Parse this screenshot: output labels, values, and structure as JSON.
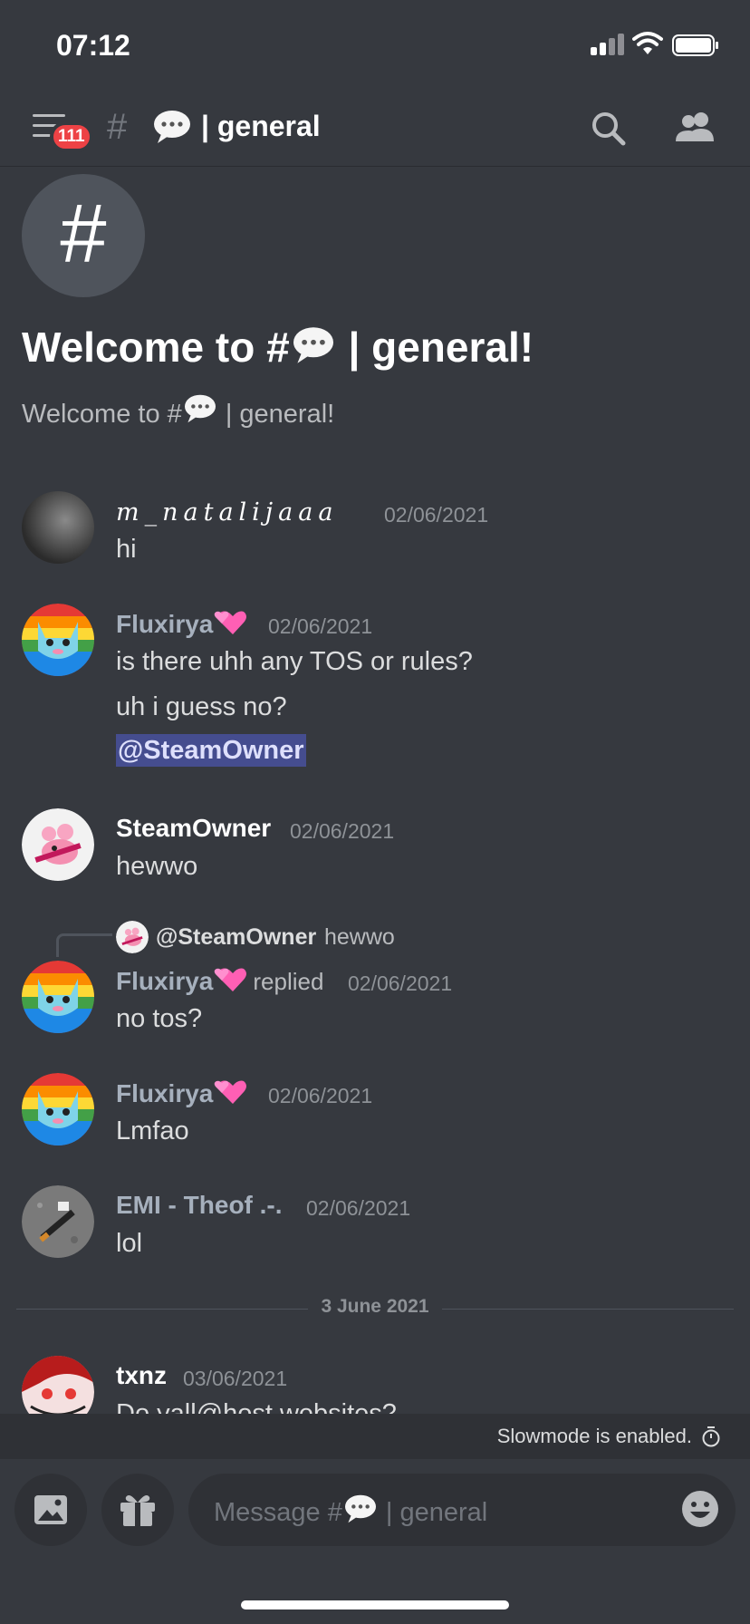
{
  "status_bar": {
    "time": "07:12"
  },
  "header": {
    "badge_count": "111",
    "hash": "#",
    "channel_name": "| general"
  },
  "welcome": {
    "hash_glyph": "#",
    "title_prefix": "Welcome to #",
    "title_suffix": " | general!",
    "subtitle_prefix": "Welcome to #",
    "subtitle_suffix": " | general!"
  },
  "messages": [
    {
      "author": "m_natalijaaa",
      "timestamp": "02/06/2021",
      "lines": [
        "hi"
      ]
    },
    {
      "author": "Fluxirya",
      "timestamp": "02/06/2021",
      "lines": [
        "is there uhh any TOS or rules?",
        "uh i guess no?"
      ],
      "mention": "@SteamOwner"
    },
    {
      "author": "SteamOwner",
      "timestamp": "02/06/2021",
      "lines": [
        "hewwo"
      ]
    },
    {
      "reply_to": {
        "author": "@SteamOwner",
        "text": "hewwo"
      },
      "author": "Fluxirya",
      "replied_label": "replied",
      "timestamp": "02/06/2021",
      "lines": [
        "no tos?"
      ]
    },
    {
      "author": "Fluxirya",
      "timestamp": "02/06/2021",
      "lines": [
        "Lmfao"
      ]
    },
    {
      "author": "EMI - Theof .-.",
      "timestamp": "02/06/2021",
      "lines": [
        "lol"
      ]
    },
    {
      "author": "txnz",
      "timestamp": "03/06/2021",
      "lines": [
        "Do yall@host websites?"
      ]
    }
  ],
  "date_divider": "3 June 2021",
  "slowmode": {
    "text": "Slowmode is enabled."
  },
  "composer": {
    "placeholder_prefix": "Message #",
    "placeholder_suffix": " | general"
  },
  "colors": {
    "background": "#36393f",
    "mention_bg": "#5865f2",
    "badge": "#ed4245",
    "heart": "#ff5fb4"
  }
}
